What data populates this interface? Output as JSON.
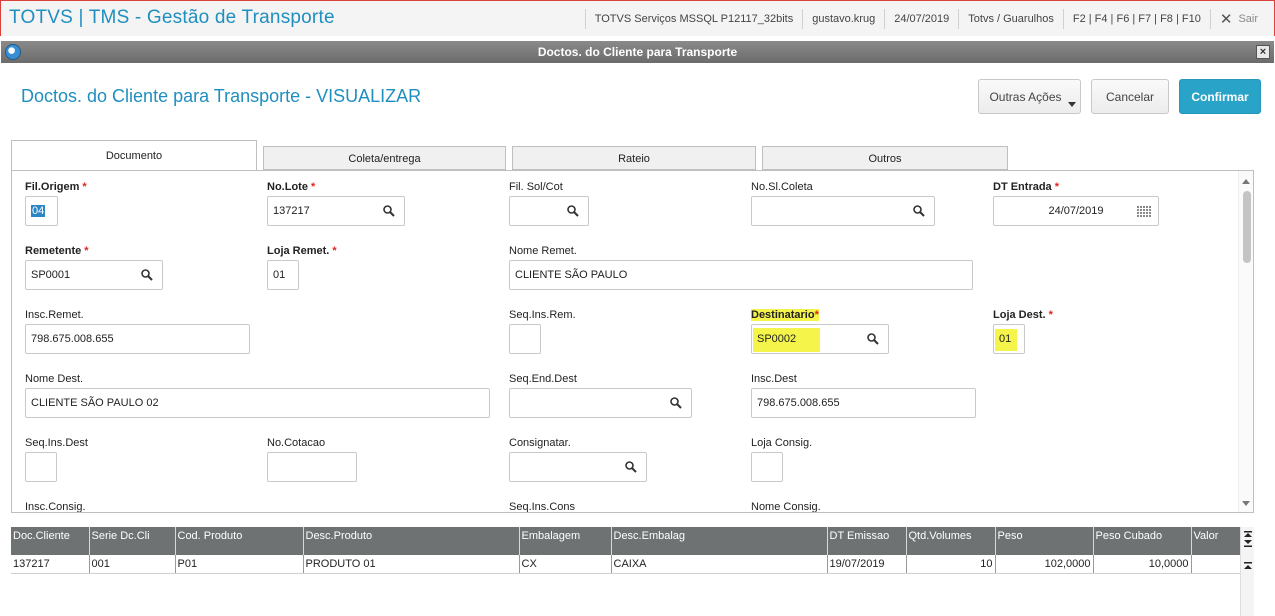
{
  "app": {
    "title": "TOTVS | TMS - Gestão de Transporte",
    "environment": "TOTVS Serviços MSSQL P12117_32bits",
    "user": "gustavo.krug",
    "date": "24/07/2019",
    "branch": "Totvs / Guarulhos",
    "shortcuts": "F2 | F4 | F6 | F7 | F8 | F10",
    "exit_label": "Sair"
  },
  "window": {
    "title": "Doctos. do Cliente para Transporte"
  },
  "header": {
    "title": "Doctos. do Cliente para Transporte - VISUALIZAR",
    "other_actions_label": "Outras Ações",
    "cancel_label": "Cancelar",
    "confirm_label": "Confirmar"
  },
  "tabs": [
    {
      "label": "Documento"
    },
    {
      "label": "Coleta/entrega"
    },
    {
      "label": "Rateio"
    },
    {
      "label": "Outros"
    }
  ],
  "form": {
    "fil_origem": {
      "label": "Fil.Origem",
      "value": "04"
    },
    "no_lote": {
      "label": "No.Lote",
      "value": "137217"
    },
    "fil_sol_cot": {
      "label": "Fil. Sol/Cot",
      "value": ""
    },
    "no_sl_coleta": {
      "label": "No.Sl.Coleta",
      "value": ""
    },
    "dt_entrada": {
      "label": "DT Entrada",
      "value": "24/07/2019"
    },
    "remetente": {
      "label": "Remetente",
      "value": "SP0001"
    },
    "loja_remet": {
      "label": "Loja Remet.",
      "value": "01"
    },
    "nome_remet": {
      "label": "Nome Remet.",
      "value": "CLIENTE SÃO PAULO"
    },
    "insc_remet": {
      "label": "Insc.Remet.",
      "value": "798.675.008.655"
    },
    "seq_ins_rem": {
      "label": "Seq.Ins.Rem.",
      "value": ""
    },
    "destinatario": {
      "label": "Destinatario",
      "value": "SP0002"
    },
    "loja_dest": {
      "label": "Loja Dest.",
      "value": "01"
    },
    "nome_dest": {
      "label": "Nome Dest.",
      "value": "CLIENTE SÃO PAULO 02"
    },
    "seq_end_dest": {
      "label": "Seq.End.Dest",
      "value": ""
    },
    "insc_dest": {
      "label": "Insc.Dest",
      "value": "798.675.008.655"
    },
    "seq_ins_dest": {
      "label": "Seq.Ins.Dest",
      "value": ""
    },
    "no_cotacao": {
      "label": "No.Cotacao",
      "value": ""
    },
    "consignatar": {
      "label": "Consignatar.",
      "value": ""
    },
    "loja_consig": {
      "label": "Loja Consig.",
      "value": ""
    },
    "insc_consig": {
      "label": "Insc.Consig."
    },
    "seq_ins_cons": {
      "label": "Seq.Ins.Cons"
    },
    "nome_consig": {
      "label": "Nome Consig."
    }
  },
  "grid": {
    "columns": [
      "Doc.Cliente",
      "Serie Dc.Cli",
      "Cod. Produto",
      "Desc.Produto",
      "Embalagem",
      "Desc.Embalag",
      "DT Emissao",
      "Qtd.Volumes",
      "Peso",
      "Peso Cubado",
      "Valor"
    ],
    "rows": [
      [
        "137217",
        "001",
        "P01",
        "PRODUTO 01",
        "CX",
        "CAIXA",
        "19/07/2019",
        "10",
        "102,0000",
        "10,0000",
        ""
      ]
    ]
  },
  "colors": {
    "accent": "#1f8fbf",
    "confirm": "#2aa3c9",
    "required": "#e0251b",
    "highlight": "#f4f44a",
    "grid_header": "#6f7273"
  }
}
